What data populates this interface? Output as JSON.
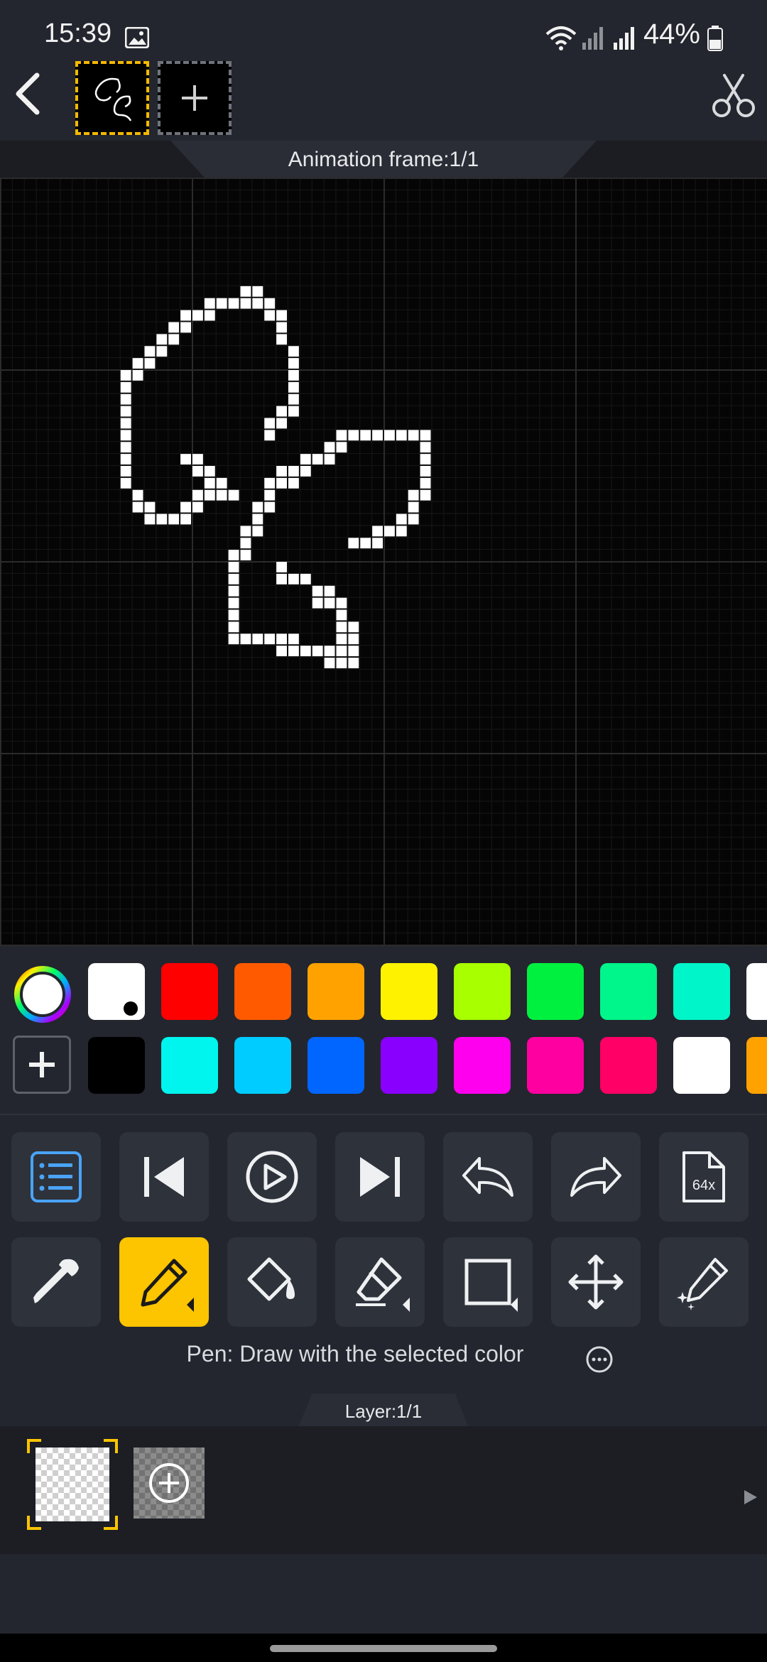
{
  "status_bar": {
    "time": "15:39",
    "battery": "44%",
    "icons": [
      "gallery-icon",
      "wifi-icon",
      "signal-icon",
      "signal-icon",
      "battery-icon"
    ]
  },
  "top_bar": {
    "back_icon": "chevron-left-icon",
    "frames_count": 1,
    "add_frame_icon": "plus-icon",
    "cut_icon": "scissors-icon"
  },
  "frame_label": "Animation frame:1/1",
  "canvas": {
    "grid_cells": 64,
    "background": "#050505",
    "pixel_color": "#ffffff",
    "pixels": [
      [
        20,
        9
      ],
      [
        21,
        9
      ],
      [
        19,
        10
      ],
      [
        20,
        10
      ],
      [
        21,
        10
      ],
      [
        22,
        10
      ],
      [
        17,
        10
      ],
      [
        18,
        10
      ],
      [
        15,
        11
      ],
      [
        16,
        11
      ],
      [
        17,
        11
      ],
      [
        22,
        11
      ],
      [
        23,
        11
      ],
      [
        14,
        12
      ],
      [
        15,
        12
      ],
      [
        23,
        12
      ],
      [
        13,
        13
      ],
      [
        14,
        13
      ],
      [
        23,
        13
      ],
      [
        12,
        14
      ],
      [
        13,
        14
      ],
      [
        24,
        14
      ],
      [
        11,
        15
      ],
      [
        12,
        15
      ],
      [
        24,
        15
      ],
      [
        10,
        16
      ],
      [
        11,
        16
      ],
      [
        24,
        16
      ],
      [
        10,
        17
      ],
      [
        24,
        17
      ],
      [
        10,
        18
      ],
      [
        24,
        18
      ],
      [
        10,
        19
      ],
      [
        23,
        19
      ],
      [
        24,
        19
      ],
      [
        10,
        20
      ],
      [
        22,
        20
      ],
      [
        23,
        20
      ],
      [
        10,
        21
      ],
      [
        22,
        21
      ],
      [
        28,
        21
      ],
      [
        29,
        21
      ],
      [
        30,
        21
      ],
      [
        31,
        21
      ],
      [
        32,
        21
      ],
      [
        33,
        21
      ],
      [
        34,
        21
      ],
      [
        35,
        21
      ],
      [
        10,
        22
      ],
      [
        27,
        22
      ],
      [
        28,
        22
      ],
      [
        35,
        22
      ],
      [
        10,
        23
      ],
      [
        15,
        23
      ],
      [
        16,
        23
      ],
      [
        25,
        23
      ],
      [
        26,
        23
      ],
      [
        27,
        23
      ],
      [
        35,
        23
      ],
      [
        10,
        24
      ],
      [
        16,
        24
      ],
      [
        17,
        24
      ],
      [
        23,
        24
      ],
      [
        24,
        24
      ],
      [
        25,
        24
      ],
      [
        35,
        24
      ],
      [
        10,
        25
      ],
      [
        17,
        25
      ],
      [
        18,
        25
      ],
      [
        23,
        25
      ],
      [
        24,
        25
      ],
      [
        22,
        25
      ],
      [
        35,
        25
      ],
      [
        11,
        26
      ],
      [
        16,
        26
      ],
      [
        17,
        26
      ],
      [
        18,
        26
      ],
      [
        19,
        26
      ],
      [
        22,
        26
      ],
      [
        35,
        26
      ],
      [
        34,
        26
      ],
      [
        11,
        27
      ],
      [
        12,
        27
      ],
      [
        15,
        27
      ],
      [
        16,
        27
      ],
      [
        21,
        27
      ],
      [
        22,
        27
      ],
      [
        34,
        27
      ],
      [
        12,
        28
      ],
      [
        13,
        28
      ],
      [
        14,
        28
      ],
      [
        15,
        28
      ],
      [
        21,
        28
      ],
      [
        33,
        28
      ],
      [
        34,
        28
      ],
      [
        20,
        29
      ],
      [
        21,
        29
      ],
      [
        31,
        29
      ],
      [
        32,
        29
      ],
      [
        33,
        29
      ],
      [
        20,
        30
      ],
      [
        29,
        30
      ],
      [
        30,
        30
      ],
      [
        31,
        30
      ],
      [
        20,
        31
      ],
      [
        19,
        31
      ],
      [
        19,
        32
      ],
      [
        19,
        33
      ],
      [
        19,
        34
      ],
      [
        19,
        35
      ],
      [
        19,
        36
      ],
      [
        19,
        37
      ],
      [
        23,
        32
      ],
      [
        23,
        33
      ],
      [
        24,
        33
      ],
      [
        25,
        33
      ],
      [
        26,
        34
      ],
      [
        27,
        34
      ],
      [
        26,
        35
      ],
      [
        27,
        35
      ],
      [
        28,
        35
      ],
      [
        19,
        38
      ],
      [
        20,
        38
      ],
      [
        21,
        38
      ],
      [
        22,
        38
      ],
      [
        23,
        38
      ],
      [
        24,
        38
      ],
      [
        28,
        36
      ],
      [
        28,
        37
      ],
      [
        29,
        37
      ],
      [
        23,
        39
      ],
      [
        24,
        39
      ],
      [
        25,
        39
      ],
      [
        26,
        39
      ],
      [
        27,
        39
      ],
      [
        28,
        39
      ],
      [
        29,
        39
      ],
      [
        29,
        38
      ],
      [
        27,
        40
      ],
      [
        28,
        40
      ],
      [
        29,
        40
      ],
      [
        28,
        38
      ]
    ]
  },
  "palette": {
    "row1": [
      "#ffffff",
      "#ff0000",
      "#ff5a00",
      "#ffa200",
      "#fff200",
      "#a8ff00",
      "#00f040",
      "#00f58a",
      "#00f5c8",
      "#ffffff"
    ],
    "row2": [
      "#000000",
      "#00f5ee",
      "#00ccff",
      "#0066ff",
      "#8a00ff",
      "#ff00ee",
      "#ff00a0",
      "#ff0066",
      "#ffffff",
      "#ffa200"
    ],
    "color_wheel_icon": "color-wheel-icon",
    "add_color_icon": "plus-icon"
  },
  "toolbar": {
    "row1": [
      "list-icon",
      "skip-back-icon",
      "play-icon",
      "skip-forward-icon",
      "undo-icon",
      "redo-icon",
      "export-64x-icon"
    ],
    "row2": [
      "eyedropper-icon",
      "pencil-icon",
      "fill-bucket-icon",
      "eraser-icon",
      "rectangle-icon",
      "move-icon",
      "sparkle-pen-icon"
    ],
    "export_label": "64x",
    "tool_description": "Pen: Draw with the selected color",
    "more_icon": "more-icon"
  },
  "layer": {
    "label": "Layer:1/1",
    "add_layer_icon": "plus-circle-icon",
    "expand_icon": "triangle-right-icon"
  },
  "colors": {
    "accent": "#fdc400",
    "button_bg": "#2e323b",
    "active_blue": "#4aa3f7"
  }
}
